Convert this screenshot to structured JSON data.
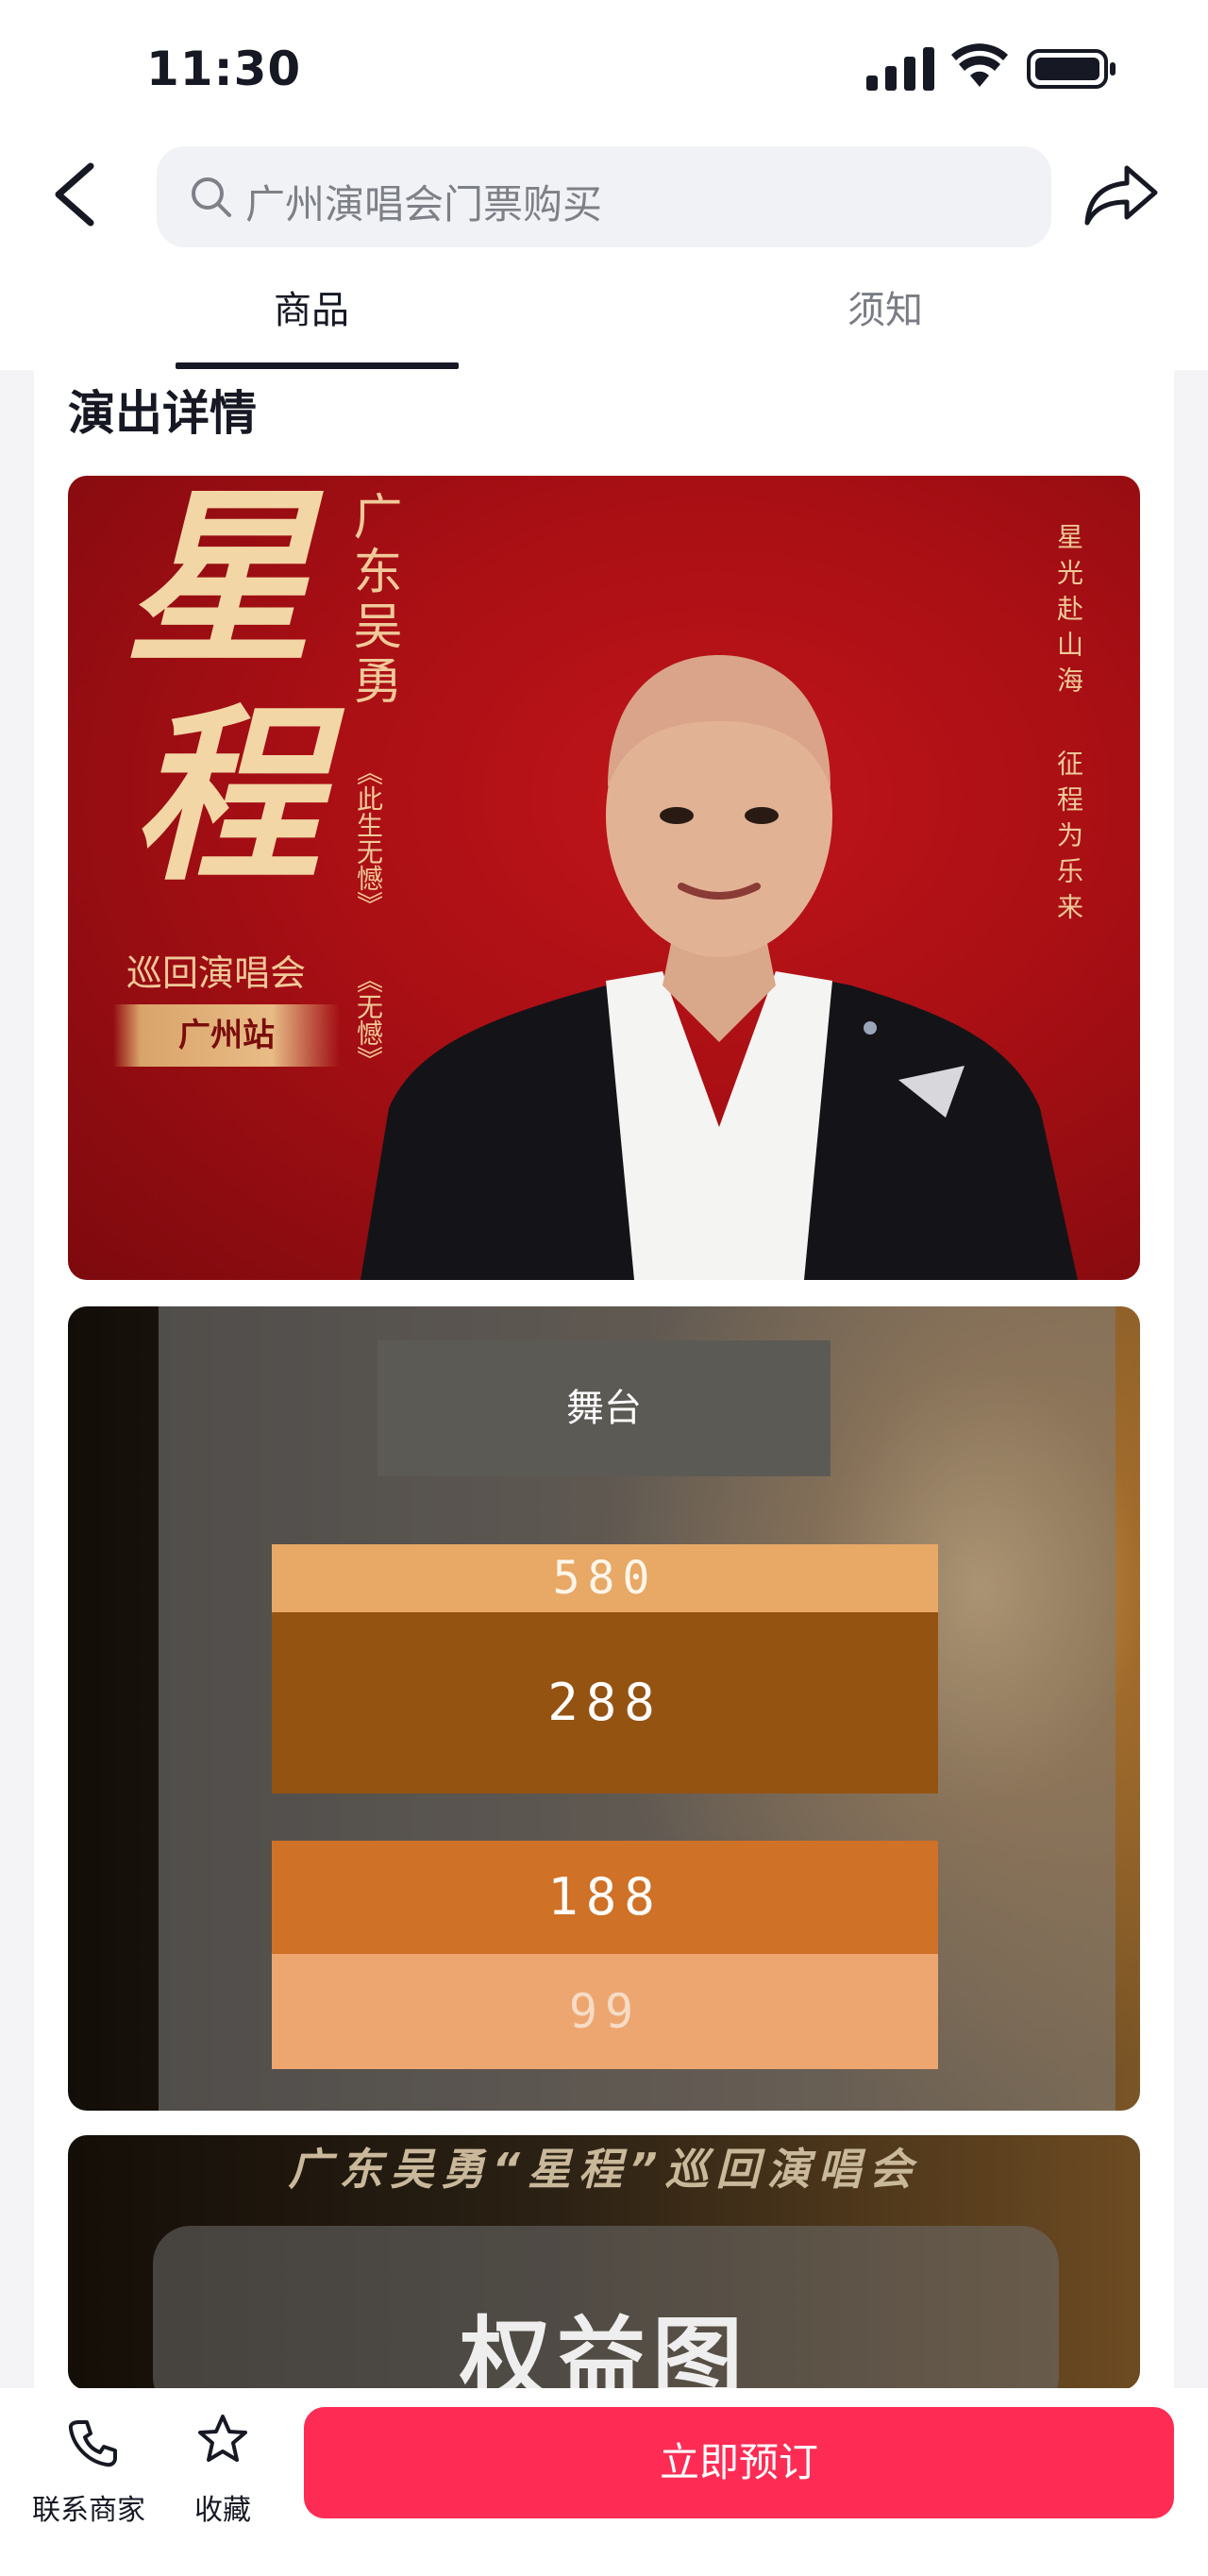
{
  "status_bar": {
    "time": "11:30"
  },
  "header": {
    "search_placeholder": "广州演唱会门票购买"
  },
  "tabs": [
    {
      "label": "商品",
      "active": true
    },
    {
      "label": "须知",
      "active": false
    }
  ],
  "section": {
    "title": "演出详情"
  },
  "poster_main": {
    "calligraphy_1": "星",
    "calligraphy_2": "程",
    "artist": "广东吴勇",
    "song_1": "《此生无憾》",
    "song_2": "《无憾》",
    "tour": "巡回演唱会",
    "station": "广州站",
    "slogan_1": "星光赴山海",
    "slogan_2": "征程为乐来"
  },
  "seat_map": {
    "stage_label": "舞台",
    "zones": [
      {
        "price": "580",
        "color": "#e8a866"
      },
      {
        "price": "288",
        "color": "#955312"
      },
      {
        "price": "188",
        "color": "#cf7126"
      },
      {
        "price": "99",
        "color": "#eea670"
      }
    ]
  },
  "poster_benefits": {
    "title": "广东吴勇“星程”巡回演唱会",
    "big_text": "权益图"
  },
  "bottom_bar": {
    "contact_label": "联系商家",
    "favorite_label": "收藏",
    "cta_label": "立即预订"
  },
  "colors": {
    "accent": "#fe2c55",
    "poster_red": "#a80f14",
    "gold": "#f3d6a6"
  }
}
